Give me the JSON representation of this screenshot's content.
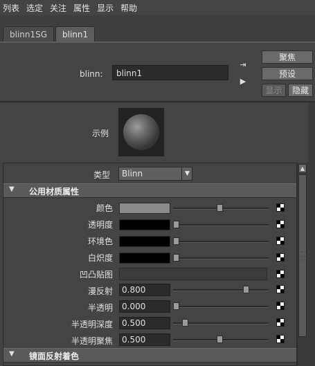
{
  "menubar": {
    "items": [
      "列表",
      "选定",
      "关注",
      "属性",
      "显示",
      "帮助"
    ]
  },
  "tabs": [
    {
      "label": "blinn1SG",
      "active": false
    },
    {
      "label": "blinn1",
      "active": true
    }
  ],
  "node": {
    "type_label": "blinn:",
    "name": "blinn1"
  },
  "header_buttons": {
    "focus": "聚焦",
    "presets": "预设",
    "show": "显示",
    "hide": "隐藏"
  },
  "preview": {
    "label": "示例"
  },
  "type_row": {
    "label": "类型",
    "value": "Blinn"
  },
  "sections": {
    "common": "公用材质属性",
    "specular": "镜面反射着色"
  },
  "attributes": [
    {
      "label": "颜色",
      "kind": "color",
      "color": "#8a8a8a",
      "slider": 0.48
    },
    {
      "label": "透明度",
      "kind": "color",
      "color": "#000000",
      "slider": 0.0
    },
    {
      "label": "环境色",
      "kind": "color",
      "color": "#000000",
      "slider": 0.0
    },
    {
      "label": "白炽度",
      "kind": "color",
      "color": "#000000",
      "slider": 0.0
    },
    {
      "label": "凹凸贴图",
      "kind": "texture"
    },
    {
      "label": "漫反射",
      "kind": "number",
      "value": "0.800",
      "slider": 0.8
    },
    {
      "label": "半透明",
      "kind": "number",
      "value": "0.000",
      "slider": 0.0
    },
    {
      "label": "半透明深度",
      "kind": "number",
      "value": "0.500",
      "slider": 0.1
    },
    {
      "label": "半透明聚焦",
      "kind": "number",
      "value": "0.500",
      "slider": 0.5
    }
  ],
  "icons": {
    "map_button": "checker-map-icon",
    "connect_in": "input-connection-icon",
    "connect_out": "output-connection-icon"
  }
}
